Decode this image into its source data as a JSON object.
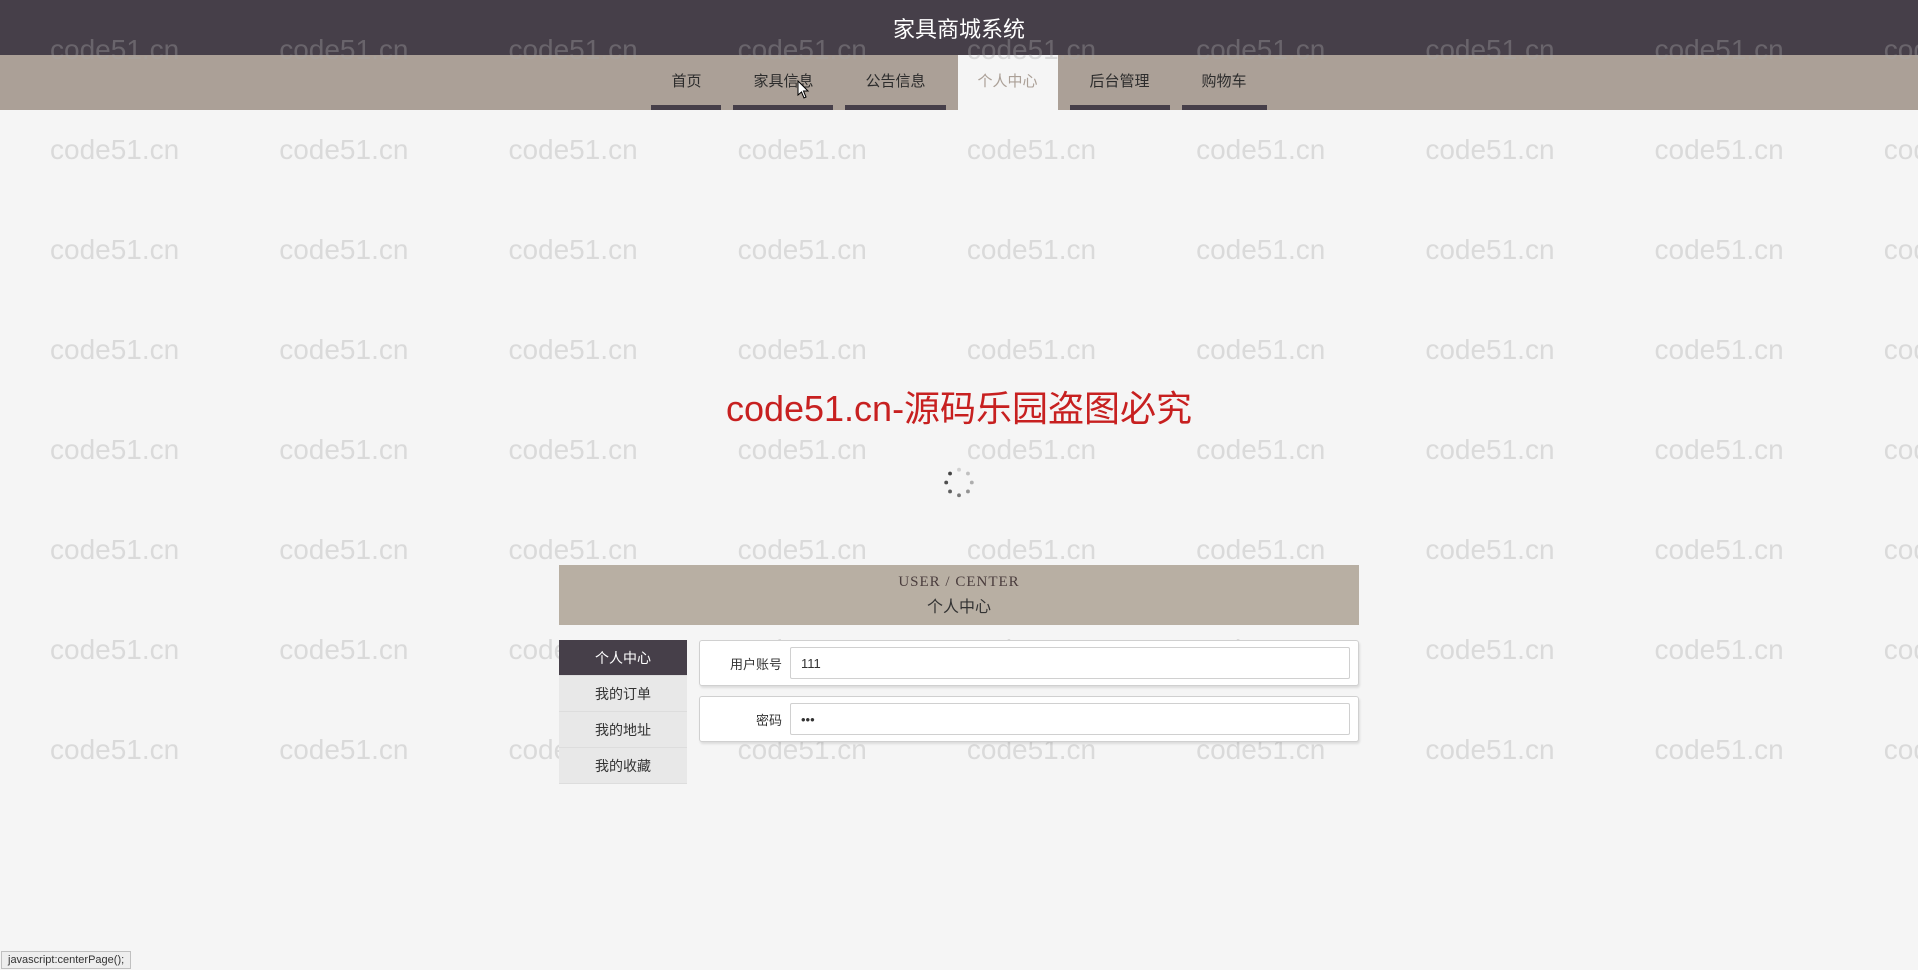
{
  "header": {
    "title": "家具商城系统"
  },
  "nav": {
    "items": [
      {
        "label": "首页",
        "active": false
      },
      {
        "label": "家具信息",
        "active": false
      },
      {
        "label": "公告信息",
        "active": false
      },
      {
        "label": "个人中心",
        "active": true
      },
      {
        "label": "后台管理",
        "active": false
      },
      {
        "label": "购物车",
        "active": false
      }
    ]
  },
  "watermark": {
    "text": "code51.cn",
    "banner": "code51.cn-源码乐园盗图必究"
  },
  "section": {
    "header_en": "USER / CENTER",
    "header_cn": "个人中心"
  },
  "sidebar": {
    "items": [
      {
        "label": "个人中心",
        "active": true
      },
      {
        "label": "我的订单",
        "active": false
      },
      {
        "label": "我的地址",
        "active": false
      },
      {
        "label": "我的收藏",
        "active": false
      }
    ]
  },
  "form": {
    "rows": [
      {
        "label": "用户账号",
        "value": "111",
        "type": "text"
      },
      {
        "label": "密码",
        "value": "•••",
        "type": "password"
      }
    ]
  },
  "status_bar": {
    "text": "javascript:centerPage();"
  }
}
